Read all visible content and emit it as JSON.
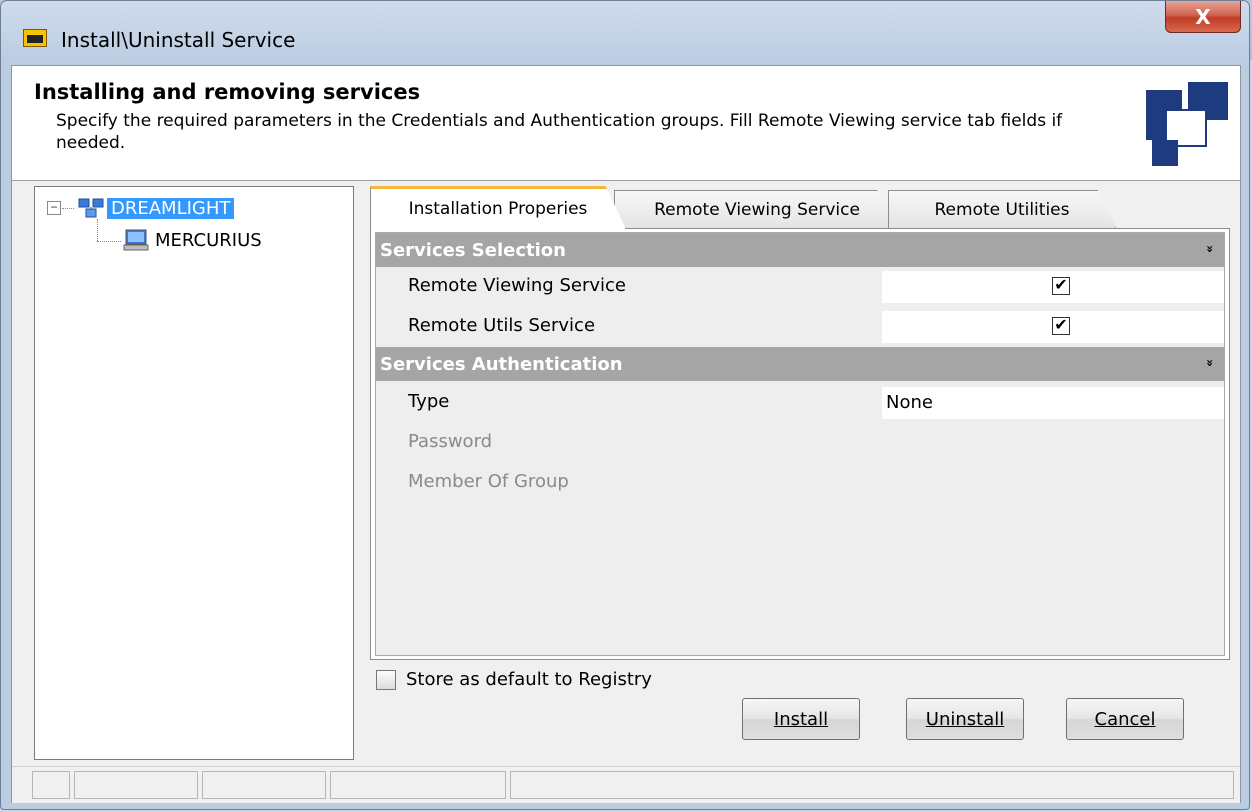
{
  "window": {
    "title": "Install\\Uninstall Service",
    "close_label": "X"
  },
  "header": {
    "title": "Installing and removing services",
    "description": "Specify the required parameters in the Credentials and Authentication groups. Fill Remote Viewing service tab fields if needed."
  },
  "tree": {
    "root": {
      "label": "DREAMLIGHT",
      "expander": "−"
    },
    "children": [
      {
        "label": "MERCURIUS"
      }
    ]
  },
  "tabs": [
    {
      "label": "Installation Properies",
      "active": true
    },
    {
      "label": "Remote Viewing Service",
      "active": false
    },
    {
      "label": "Remote Utilities",
      "active": false
    }
  ],
  "groups": {
    "selection": {
      "title": "Services Selection",
      "rows": [
        {
          "name": "Remote Viewing Service",
          "checked": "✔"
        },
        {
          "name": "Remote Utils Service",
          "checked": "✔"
        }
      ]
    },
    "authentication": {
      "title": "Services Authentication",
      "rows": [
        {
          "name": "Type",
          "value": "None"
        },
        {
          "name": "Password"
        },
        {
          "name": "Member Of Group"
        }
      ]
    },
    "collapse_glyph": "»"
  },
  "store_default": {
    "label": "Store as default to Registry",
    "checked": false
  },
  "buttons": {
    "install": "Install",
    "uninstall": "Uninstall",
    "cancel": "Cancel"
  },
  "colors": {
    "selection": "#3399ff",
    "group_header": "#a5a5a5",
    "active_tab_accent": "#f5b73a",
    "close_button": "#c13c26"
  }
}
